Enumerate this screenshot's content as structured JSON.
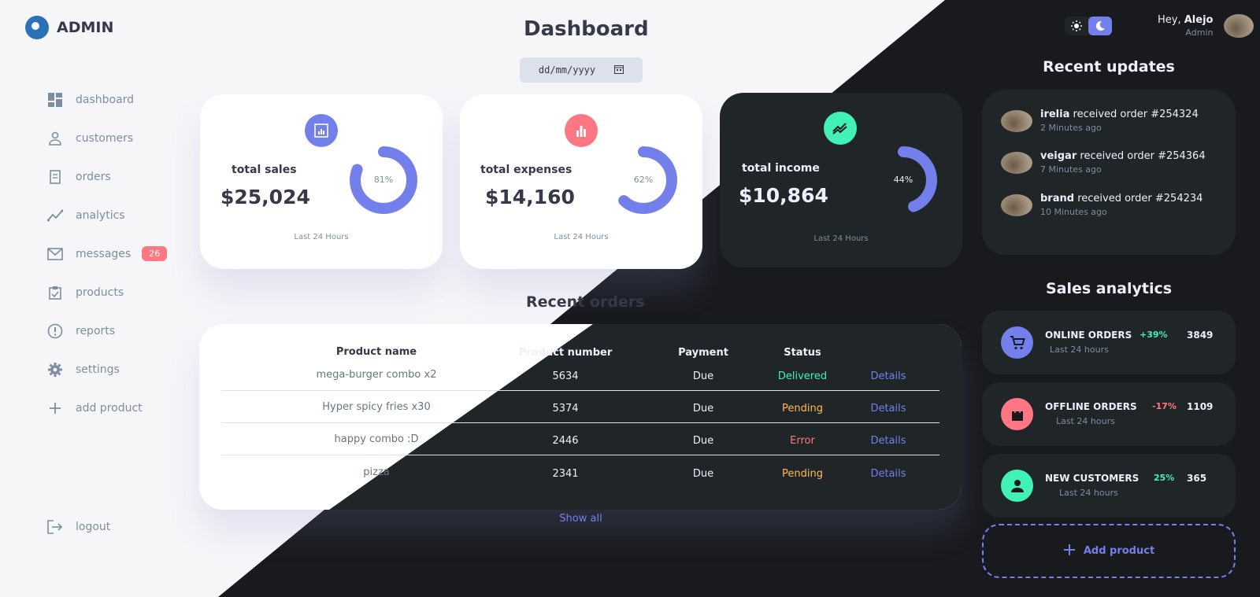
{
  "sidebar": {
    "logo_text": "ADMIN",
    "items": [
      {
        "label": "dashboard",
        "icon": "grid-icon"
      },
      {
        "label": "customers",
        "icon": "person-icon"
      },
      {
        "label": "orders",
        "icon": "receipt-icon"
      },
      {
        "label": "analytics",
        "icon": "insights-icon"
      },
      {
        "label": "messages",
        "icon": "mail-icon",
        "badge": "26"
      },
      {
        "label": "products",
        "icon": "clipboard-icon"
      },
      {
        "label": "reports",
        "icon": "alert-icon"
      },
      {
        "label": "settings",
        "icon": "gear-icon"
      },
      {
        "label": "add product",
        "icon": "plus-icon"
      }
    ],
    "logout_label": "logout"
  },
  "header": {
    "title": "Dashboard",
    "date_placeholder": "dd/mm/yyyy"
  },
  "cards": [
    {
      "label": "total sales",
      "value": "$25,024",
      "percent": 81,
      "percent_text": "81%",
      "footer": "Last 24 Hours",
      "icon_color": "#7380ec"
    },
    {
      "label": "total expenses",
      "value": "$14,160",
      "percent": 62,
      "percent_text": "62%",
      "footer": "Last 24 Hours",
      "icon_color": "#ff7782"
    },
    {
      "label": "total income",
      "value": "$10,864",
      "percent": 44,
      "percent_text": "44%",
      "footer": "Last 24 Hours",
      "icon_color": "#41f1b6"
    }
  ],
  "orders": {
    "title": "Recent orders",
    "headers": [
      "Product name",
      "Product number",
      "Payment",
      "Status"
    ],
    "rows": [
      {
        "name": "mega-burger combo x2",
        "number": "5634",
        "payment": "Due",
        "status": "Delivered",
        "action": "Details"
      },
      {
        "name": "Hyper spicy fries x30",
        "number": "5374",
        "payment": "Due",
        "status": "Pending",
        "action": "Details"
      },
      {
        "name": "happy combo :D",
        "number": "2446",
        "payment": "Due",
        "status": "Error",
        "action": "Details"
      },
      {
        "name": "pizza",
        "number": "2341",
        "payment": "Due",
        "status": "Pending",
        "action": "Details"
      }
    ],
    "show_all": "Show all"
  },
  "profile": {
    "greeting": "Hey,",
    "name": "Alejo",
    "role": "Admin"
  },
  "updates": {
    "title": "Recent updates",
    "items": [
      {
        "user": "irelia",
        "text": "received order #254324",
        "time": "2 Minutes ago"
      },
      {
        "user": "veigar",
        "text": "received order #254364",
        "time": "7 Minutes ago"
      },
      {
        "user": "brand",
        "text": "received order #254234",
        "time": "10 Minutes ago"
      }
    ]
  },
  "analytics": {
    "title": "Sales analytics",
    "items": [
      {
        "title": "ONLINE ORDERS",
        "sub": "Last 24 hours",
        "pct": "+39%",
        "num": "3849",
        "icon": "cart-icon",
        "color": "#7380ec",
        "pct_color": "#41f1b6"
      },
      {
        "title": "OFFLINE ORDERS",
        "sub": "Last 24 hours",
        "pct": "-17%",
        "num": "1109",
        "icon": "bag-icon",
        "color": "#ff7782",
        "pct_color": "#ff7782"
      },
      {
        "title": "NEW CUSTOMERS",
        "sub": "Last 24 hours",
        "pct": "25%",
        "num": "365",
        "icon": "person-icon",
        "color": "#41f1b6",
        "pct_color": "#41f1b6"
      }
    ],
    "add_label": "Add product"
  },
  "colors": {
    "primary": "#7380ec",
    "danger": "#ff7782",
    "success": "#41f1b6",
    "warning": "#ffbb55"
  }
}
